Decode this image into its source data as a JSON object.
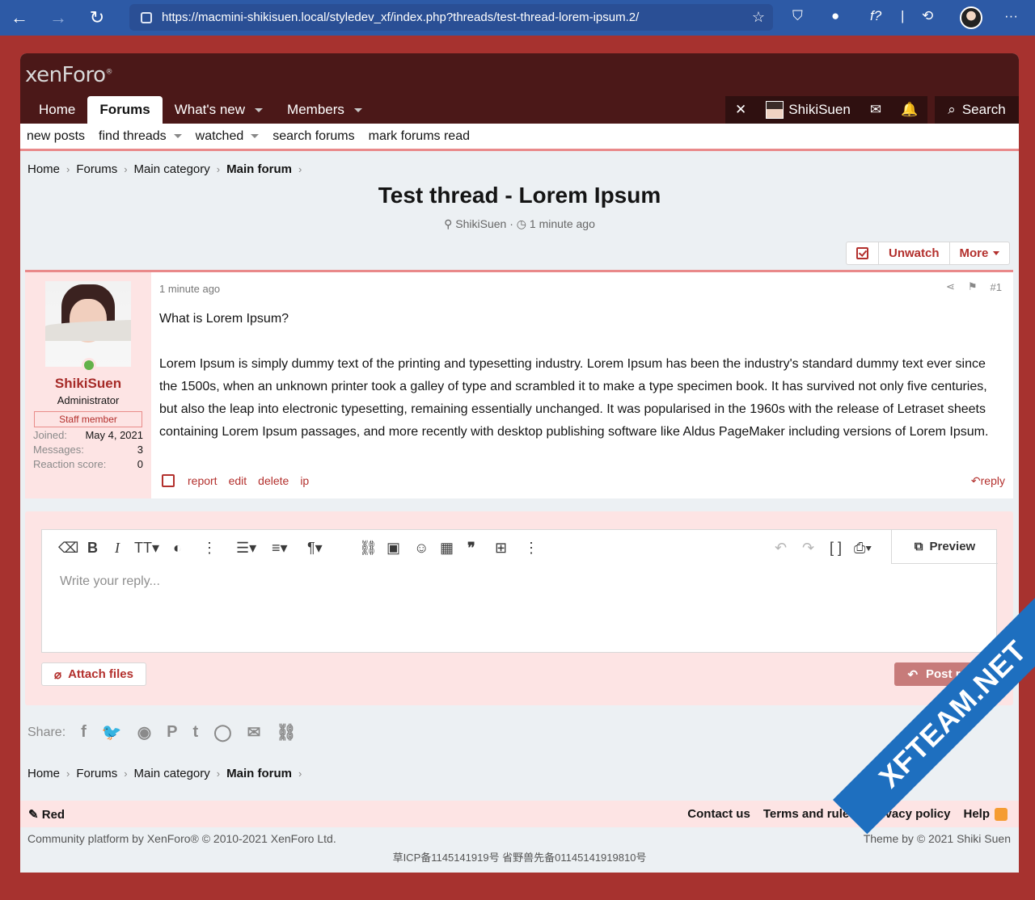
{
  "browser": {
    "url": "https://macmini-shikisuen.local/styledev_xf/index.php?threads/test-thread-lorem-ipsum.2/"
  },
  "header": {
    "logo": "xenForo",
    "tabs": [
      {
        "label": "Home"
      },
      {
        "label": "Forums"
      },
      {
        "label": "What's new"
      },
      {
        "label": "Members"
      }
    ],
    "username": "ShikiSuen",
    "search_label": "Search"
  },
  "subnav": {
    "items": [
      "new posts",
      "find threads",
      "watched",
      "search forums",
      "mark forums read"
    ]
  },
  "breadcrumb": {
    "items": [
      "Home",
      "Forums",
      "Main category",
      "Main forum"
    ]
  },
  "thread": {
    "title": "Test thread - Lorem Ipsum",
    "author": "ShikiSuen",
    "time": "1 minute ago",
    "unwatch_label": "Unwatch",
    "more_label": "More"
  },
  "post": {
    "time": "1 minute ago",
    "number": "#1",
    "user": {
      "name": "ShikiSuen",
      "title": "Administrator",
      "banner": "Staff member",
      "stats": [
        {
          "key": "Joined:",
          "value": "May 4, 2021"
        },
        {
          "key": "Messages:",
          "value": "3"
        },
        {
          "key": "Reaction score:",
          "value": "0"
        }
      ]
    },
    "paragraphs": [
      "What is Lorem Ipsum?",
      "Lorem Ipsum is simply dummy text of the printing and typesetting industry. Lorem Ipsum has been the industry's standard dummy text ever since the 1500s, when an unknown printer took a galley of type and scrambled it to make a type specimen book. It has survived not only five centuries, but also the leap into electronic typesetting, remaining essentially unchanged. It was popularised in the 1960s with the release of Letraset sheets containing Lorem Ipsum passages, and more recently with desktop publishing software like Aldus PageMaker including versions of Lorem Ipsum."
    ],
    "actions": [
      "report",
      "edit",
      "delete",
      "ip"
    ],
    "reply_label": "reply"
  },
  "editor": {
    "placeholder": "Write your reply...",
    "preview_label": "Preview",
    "attach_label": "Attach files",
    "post_reply_label": "Post reply"
  },
  "share": {
    "label": "Share:"
  },
  "footer": {
    "style_label": "Red",
    "links": [
      "Contact us",
      "Terms and rules",
      "Privacy policy",
      "Help"
    ],
    "copyright": "Community platform by XenForo® © 2010-2021 XenForo Ltd.",
    "theme_by": "Theme by © 2021 Shiki Suen",
    "icp": "草ICP备1145141919号 省野兽先备01145141919810号"
  },
  "watermark": "XFTEAM.NET",
  "colors": {
    "accent": "#b3302d",
    "header_bg": "#4b1818",
    "outer_bg": "#a7322f",
    "browser_chrome": "#2d5aa6"
  }
}
